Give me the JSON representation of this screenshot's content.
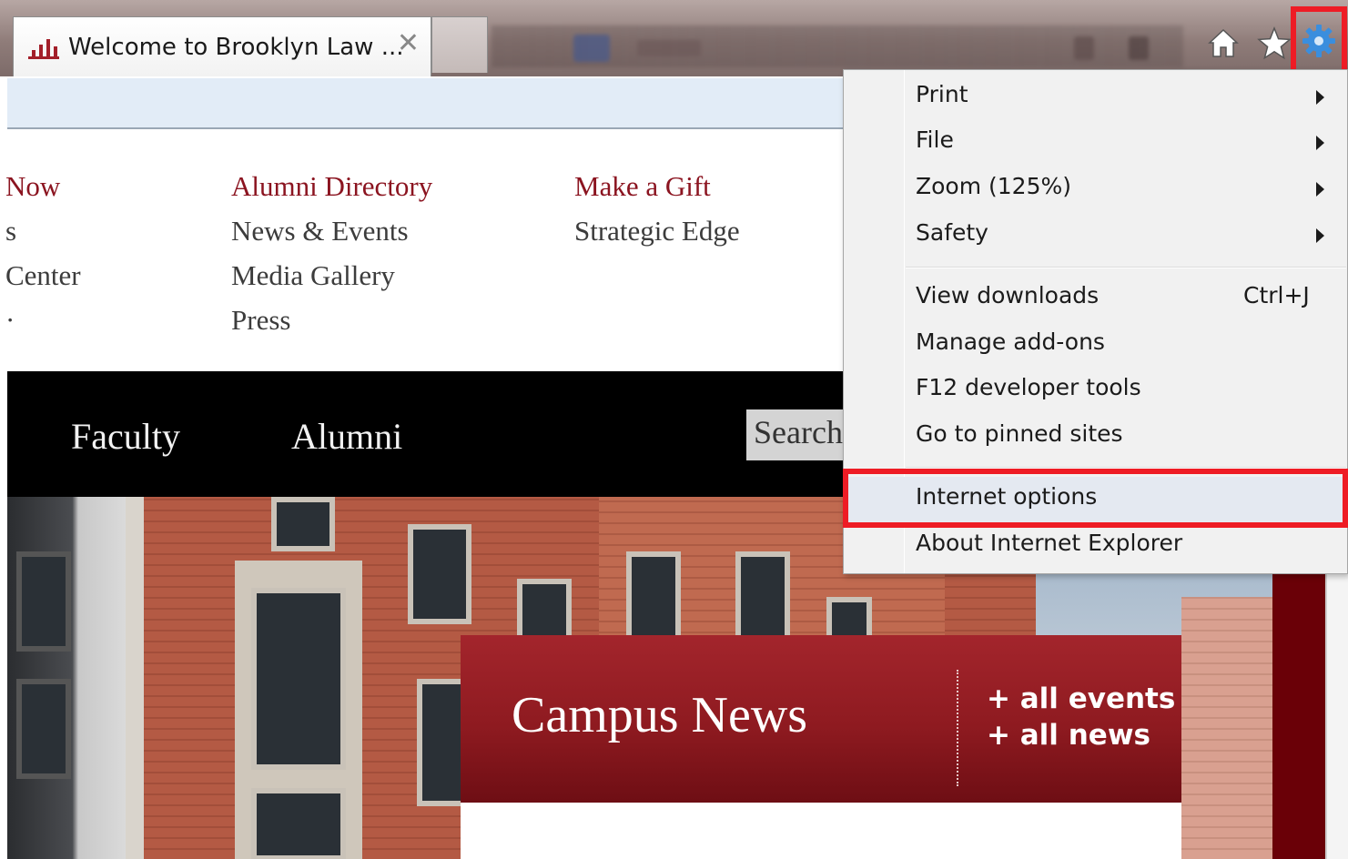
{
  "browser": {
    "tab_title": "Welcome to Brooklyn Law ...",
    "tab_close": "✕"
  },
  "site_nav": {
    "col1": [
      "Now",
      "s",
      "Center",
      "·"
    ],
    "col2": [
      {
        "label": "Alumni Directory",
        "highlight": true
      },
      {
        "label": "News & Events",
        "highlight": false
      },
      {
        "label": "Media Gallery",
        "highlight": false
      },
      {
        "label": "Press",
        "highlight": false
      }
    ],
    "col3": [
      {
        "label": "Make a Gift",
        "highlight": true
      },
      {
        "label": "Strategic Edge",
        "highlight": false
      }
    ]
  },
  "main_nav": {
    "items": [
      "Faculty",
      "Alumni"
    ],
    "search_placeholder": "Search"
  },
  "campus_news": {
    "title": "Campus News",
    "links": [
      "+ all events",
      "+ all news"
    ]
  },
  "tools_menu": {
    "items": [
      {
        "label": "Print",
        "submenu": true
      },
      {
        "label": "File",
        "submenu": true
      },
      {
        "label": "Zoom (125%)",
        "submenu": true
      },
      {
        "label": "Safety",
        "submenu": true
      },
      {
        "label": "View downloads",
        "shortcut": "Ctrl+J"
      },
      {
        "label": "Manage add-ons"
      },
      {
        "label": "F12 developer tools"
      },
      {
        "label": "Go to pinned sites"
      },
      {
        "label": "Internet options",
        "highlighted": true
      },
      {
        "label": "About Internet Explorer"
      }
    ]
  },
  "colors": {
    "brand_red": "#8b1420",
    "annotation_red": "#ee1c25",
    "nav_black": "#000000"
  },
  "icons": [
    "home-icon",
    "star-icon",
    "gear-icon",
    "close-icon",
    "chevron-right-icon"
  ]
}
